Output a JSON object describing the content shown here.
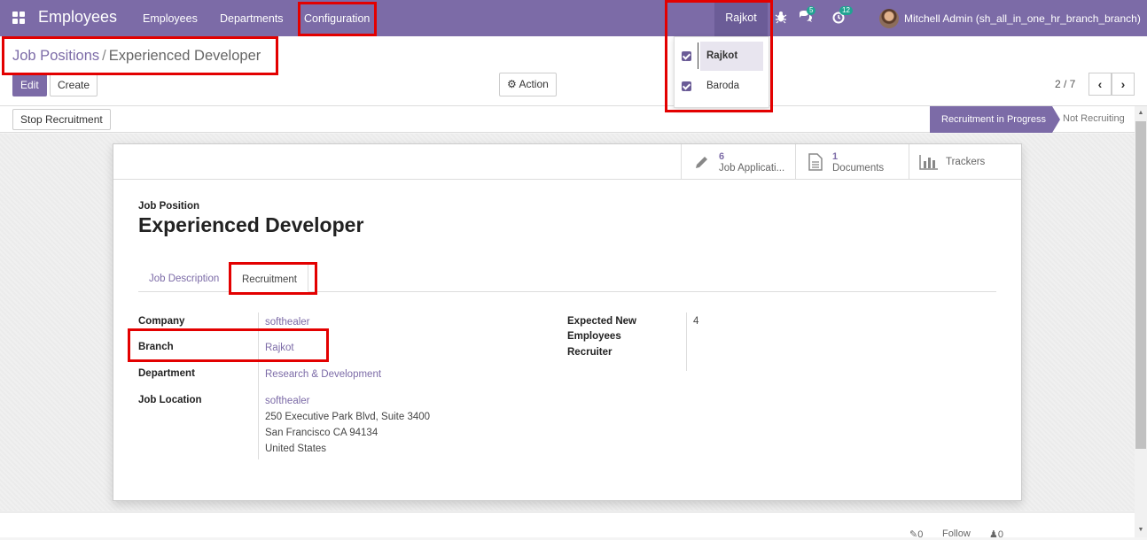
{
  "navbar": {
    "app_title": "Employees",
    "menus": [
      "Employees",
      "Departments",
      "Configuration"
    ],
    "current_branch": "Rajkot",
    "messages_count": "5",
    "activities_count": "12",
    "user": "Mitchell Admin (sh_all_in_one_hr_branch_branch)",
    "color": "#7c6ba7"
  },
  "branch_dropdown": {
    "items": [
      {
        "label": "Rajkot",
        "checked": true
      },
      {
        "label": "Baroda",
        "checked": true
      }
    ]
  },
  "breadcrumb": {
    "parent": "Job Positions",
    "separator": "/",
    "current": "Experienced Developer"
  },
  "toolbar": {
    "edit_label": "Edit",
    "create_label": "Create",
    "action_label": "Action"
  },
  "pager": {
    "text": "2 / 7",
    "prev": "‹",
    "next": "›"
  },
  "statusbar": {
    "stop_button": "Stop Recruitment",
    "stages": [
      "Recruitment in Progress",
      "Not Recruiting"
    ],
    "active_stage": "Recruitment in Progress"
  },
  "smart_buttons": {
    "applications": {
      "count": "6",
      "label": "Job Applicati..."
    },
    "documents": {
      "count": "1",
      "label": "Documents"
    },
    "trackers": {
      "label": "Trackers"
    }
  },
  "form": {
    "label": "Job Position",
    "title": "Experienced Developer",
    "tabs": [
      "Job Description",
      "Recruitment"
    ],
    "active_tab": "Recruitment",
    "fields": {
      "company_label": "Company",
      "company_value": "softhealer",
      "branch_label": "Branch",
      "branch_value": "Rajkot",
      "department_label": "Department",
      "department_value": "Research & Development",
      "job_location_label": "Job Location",
      "job_location_name": "softhealer",
      "job_location_address": [
        "250 Executive Park Blvd, Suite 3400",
        "San Francisco CA 94134",
        "United States"
      ],
      "expected_label_1": "Expected New",
      "expected_label_2": "Employees",
      "expected_value": "4",
      "recruiter_label": "Recruiter",
      "recruiter_value": ""
    }
  },
  "chatter": {
    "attachments": "0",
    "follow": "Follow",
    "followers": "0"
  }
}
